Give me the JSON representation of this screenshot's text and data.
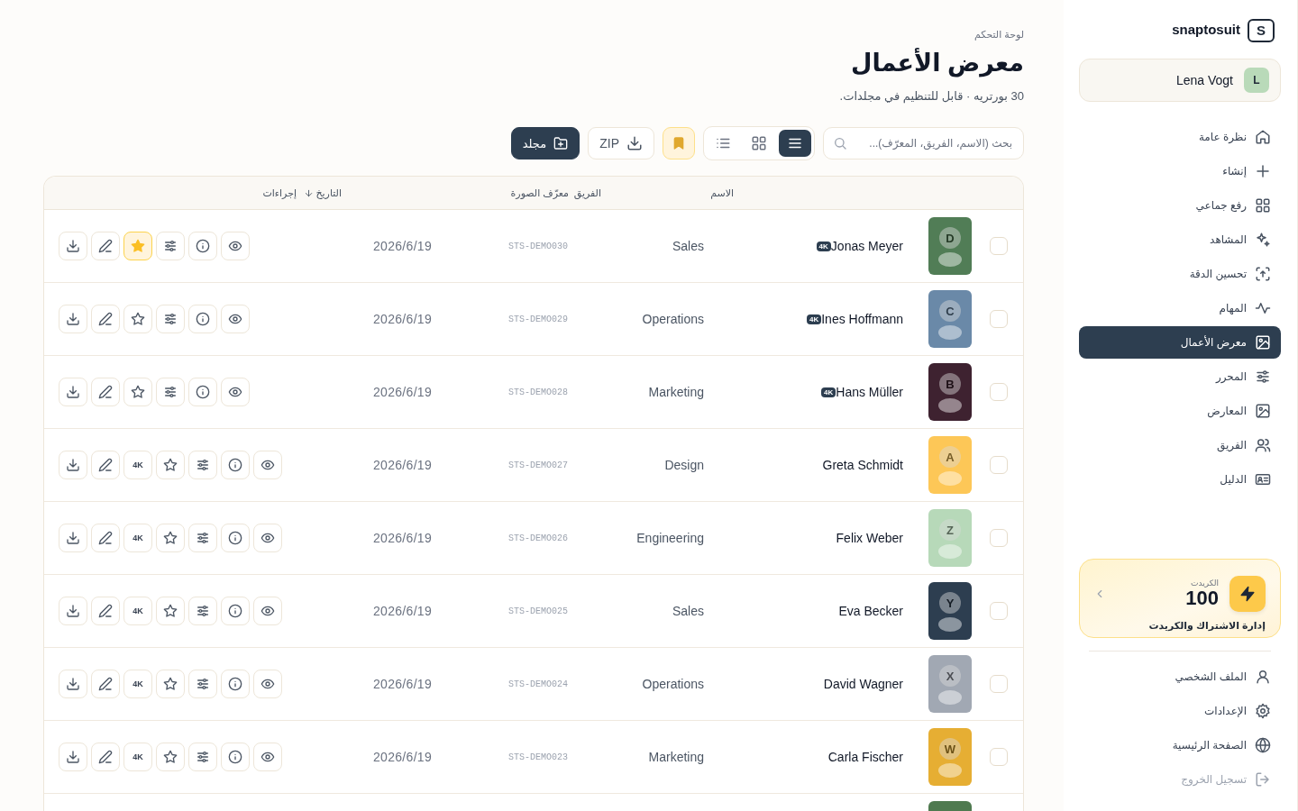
{
  "sidebar": {
    "brand": "snaptosuit",
    "logo_letter": "S",
    "user": {
      "initial": "L",
      "name": "Lena Vogt"
    },
    "nav": [
      {
        "label": "نظرة عامة",
        "kind": "home",
        "selected": false
      },
      {
        "label": "إنشاء",
        "kind": "plus",
        "selected": false
      },
      {
        "label": "رفع جماعي",
        "kind": "grid",
        "selected": false
      },
      {
        "label": "المشاهد",
        "kind": "sparkle",
        "selected": false
      },
      {
        "label": "تحسين الدقة",
        "kind": "upscale",
        "selected": false
      },
      {
        "label": "المهام",
        "kind": "activity",
        "selected": false
      },
      {
        "label": "معرض الأعمال",
        "kind": "image",
        "selected": true
      },
      {
        "label": "المحرر",
        "kind": "sliders",
        "selected": false
      },
      {
        "label": "المعارض",
        "kind": "image",
        "selected": false
      },
      {
        "label": "الفريق",
        "kind": "users",
        "selected": false
      },
      {
        "label": "الدليل",
        "kind": "idcard",
        "selected": false
      }
    ],
    "credits": {
      "label": "الكريدت",
      "amount": "100",
      "link": "إدارة الاشتراك والكريدت"
    },
    "footer": [
      {
        "label": "الملف الشخصي",
        "kind": "user",
        "muted": false
      },
      {
        "label": "الإعدادات",
        "kind": "gear",
        "muted": false
      },
      {
        "label": "الصفحة الرئيسية",
        "kind": "globe",
        "muted": false
      },
      {
        "label": "تسجيل الخروج",
        "kind": "logout",
        "muted": true
      }
    ]
  },
  "header": {
    "breadcrumb": "لوحة التحكم",
    "title": "معرض الأعمال",
    "subtitle": "30 بورتريه · قابل للتنظيم في مجلدات."
  },
  "toolbar": {
    "search": {
      "placeholder": "بحث (الاسم، الفريق، المعرّف)..."
    },
    "views": [
      {
        "kind": "rows",
        "selected": true
      },
      {
        "kind": "grid",
        "selected": false
      },
      {
        "kind": "list",
        "selected": false
      }
    ],
    "favorites_filter": {
      "on": true
    },
    "zip_button": "ZIP",
    "folder_button": "مجلد"
  },
  "table": {
    "columns": [
      {
        "label": "الاسم",
        "sorted": false
      },
      {
        "label": "الفريق",
        "sorted": false
      },
      {
        "label": "معرّف الصورة",
        "sorted": false
      },
      {
        "label": "التاريخ",
        "sorted": true
      },
      {
        "label": "إجراءات",
        "sorted": false
      }
    ],
    "rows": [
      {
        "name": "Jonas Meyer",
        "badge": "4K",
        "team": "Sales",
        "image_id": "STS-DEMO030",
        "date": "2026/6/19",
        "avatar": {
          "letter": "D",
          "color": "#517d56"
        },
        "favorite": true,
        "checked": false
      },
      {
        "name": "Ines Hoffmann",
        "badge": "4K",
        "team": "Operations",
        "image_id": "STS-DEMO029",
        "date": "2026/6/19",
        "avatar": {
          "letter": "C",
          "color": "#6a89a8"
        },
        "favorite": false,
        "checked": false
      },
      {
        "name": "Hans Müller",
        "badge": "4K",
        "team": "Marketing",
        "image_id": "STS-DEMO028",
        "date": "2026/6/19",
        "avatar": {
          "letter": "B",
          "color": "#3e2230"
        },
        "favorite": false,
        "checked": false
      },
      {
        "name": "Greta Schmidt",
        "upscale_button": "4K",
        "team": "Design",
        "image_id": "STS-DEMO027",
        "date": "2026/6/19",
        "avatar": {
          "letter": "A",
          "color": "#fdc757"
        },
        "favorite": false,
        "checked": false
      },
      {
        "name": "Felix Weber",
        "upscale_button": "4K",
        "team": "Engineering",
        "image_id": "STS-DEMO026",
        "date": "2026/6/19",
        "avatar": {
          "letter": "Z",
          "color": "#b7d9b9"
        },
        "favorite": false,
        "checked": false
      },
      {
        "name": "Eva Becker",
        "upscale_button": "4K",
        "team": "Sales",
        "image_id": "STS-DEMO025",
        "date": "2026/6/19",
        "avatar": {
          "letter": "Y",
          "color": "#2d3e50"
        },
        "favorite": false,
        "checked": false
      },
      {
        "name": "David Wagner",
        "upscale_button": "4K",
        "team": "Operations",
        "image_id": "STS-DEMO024",
        "date": "2026/6/19",
        "avatar": {
          "letter": "X",
          "color": "#a1a8b3"
        },
        "favorite": false,
        "checked": false
      },
      {
        "name": "Carla Fischer",
        "upscale_button": "4K",
        "team": "Marketing",
        "image_id": "STS-DEMO023",
        "date": "2026/6/19",
        "avatar": {
          "letter": "W",
          "color": "#e6ae33"
        },
        "favorite": false,
        "checked": false
      },
      {
        "avatar": {
          "color": "#4f7a50"
        }
      }
    ]
  }
}
